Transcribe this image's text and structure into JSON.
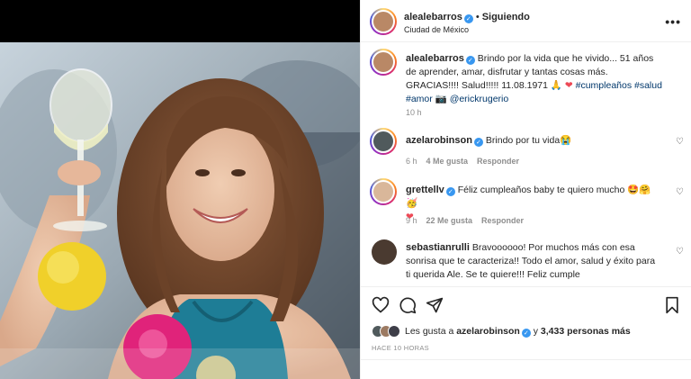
{
  "post": {
    "username": "alealebarros",
    "follow_label": "Siguiendo",
    "separator": "•",
    "location": "Ciudad de México",
    "more_label": "•••"
  },
  "caption": {
    "username": "alealebarros",
    "text_a": "Brindo por la vida que he vivido... 51 años de aprender, amar, disfrutar y tantas cosas más. GRACIAS!!!! Salud!!!!! 11.08.1971 🙏",
    "heart": "❤",
    "tags": "#cumpleaños #salud #amor",
    "camera": "📷",
    "mention": "@erickrugerio",
    "time": "10 h"
  },
  "comments": [
    {
      "username": "azelarobinson",
      "verified": true,
      "text": "Brindo por tu vida😭",
      "time": "6 h",
      "likes": "4 Me gusta",
      "reply": "Responder"
    },
    {
      "username": "grettellv",
      "verified": true,
      "text": "Féliz cumpleaños baby te quiero mucho 🤩🤗🥳",
      "heart": "❤",
      "time": "9 h",
      "likes": "22 Me gusta",
      "reply": "Responder"
    },
    {
      "username": "sebastianrulli",
      "verified": false,
      "text": "Bravoooooo! Por muchos más con esa sonrisa que te caracteriza!! Todo el amor, salud y éxito para ti querida Ale. Se te quiere!!! Feliz cumple"
    }
  ],
  "likes": {
    "prefix": "Les gusta a",
    "user": "azelarobinson",
    "joiner": "y",
    "count": "3,433 personas más"
  },
  "time_ago": "HACE 10 HORAS",
  "colors": {
    "verified": "#3897f0",
    "link": "#00376b",
    "heart": "#ed4956",
    "muted": "#8e8e8e"
  }
}
